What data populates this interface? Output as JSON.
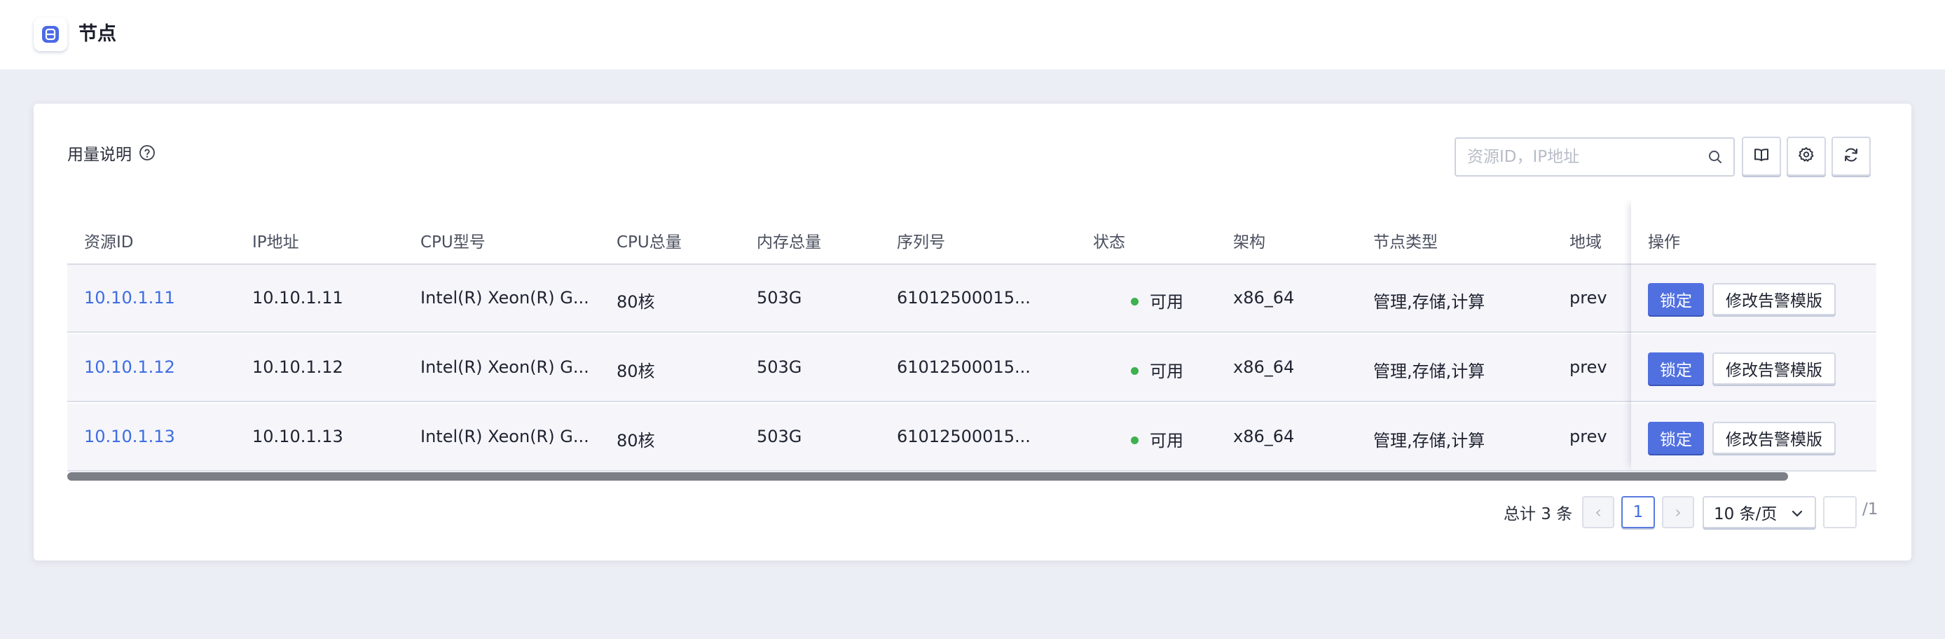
{
  "header": {
    "title": "节点",
    "icon": "node-app-icon"
  },
  "toolbar": {
    "usage_label": "用量说明",
    "search_placeholder": "资源ID，IP地址",
    "buttons": [
      "book-icon",
      "settings-gear-icon",
      "refresh-icon"
    ]
  },
  "table": {
    "columns": {
      "resource_id": "资源ID",
      "ip": "IP地址",
      "cpu_model": "CPU型号",
      "cpu_total": "CPU总量",
      "memory_total": "内存总量",
      "serial": "序列号",
      "status": "状态",
      "arch": "架构",
      "node_type": "节点类型",
      "region": "地域",
      "actions": "操作"
    },
    "rows": [
      {
        "resource_id": "10.10.1.11",
        "ip": "10.10.1.11",
        "cpu_model": "Intel(R) Xeon(R) G...",
        "cpu_total": "80核",
        "memory_total": "503G",
        "serial": "61012500015...",
        "status": "可用",
        "arch": "x86_64",
        "node_type": "管理,存储,计算",
        "region": "prev",
        "lock_label": "锁定",
        "edit_label": "修改告警模版"
      },
      {
        "resource_id": "10.10.1.12",
        "ip": "10.10.1.12",
        "cpu_model": "Intel(R) Xeon(R) G...",
        "cpu_total": "80核",
        "memory_total": "503G",
        "serial": "61012500015...",
        "status": "可用",
        "arch": "x86_64",
        "node_type": "管理,存储,计算",
        "region": "prev",
        "lock_label": "锁定",
        "edit_label": "修改告警模版"
      },
      {
        "resource_id": "10.10.1.13",
        "ip": "10.10.1.13",
        "cpu_model": "Intel(R) Xeon(R) G...",
        "cpu_total": "80核",
        "memory_total": "503G",
        "serial": "61012500015...",
        "status": "可用",
        "arch": "x86_64",
        "node_type": "管理,存储,计算",
        "region": "prev",
        "lock_label": "锁定",
        "edit_label": "修改告警模版"
      }
    ]
  },
  "pagination": {
    "total_text": "总计 3 条",
    "prev": "‹",
    "next": "›",
    "current_page": "1",
    "page_size": "10 条/页",
    "jump_value": "",
    "page_total": "/1"
  },
  "colors": {
    "accent": "#5170e0",
    "link": "#3e6de0",
    "status_ok": "#3db14e",
    "page_bg": "#eceef5"
  }
}
